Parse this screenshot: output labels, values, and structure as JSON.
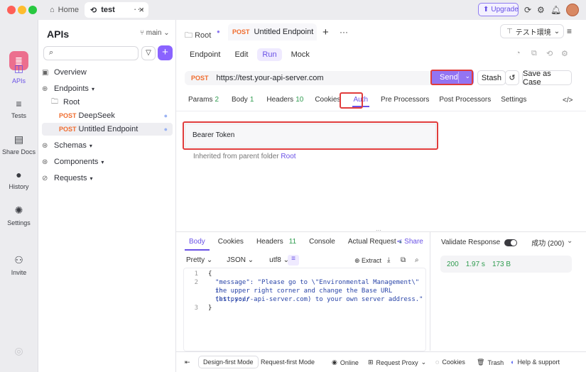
{
  "titlebar": {
    "home": "Home",
    "tab": "test",
    "more": "···",
    "upgrade": "Upgrade"
  },
  "rail": {
    "items": [
      {
        "label": "APIs",
        "icon": "api-icon"
      },
      {
        "label": "Tests",
        "icon": "tests-icon"
      },
      {
        "label": "Share Docs",
        "icon": "docs-icon"
      },
      {
        "label": "History",
        "icon": "history-icon"
      },
      {
        "label": "Settings",
        "icon": "settings-icon"
      },
      {
        "label": "Invite",
        "icon": "invite-icon"
      }
    ]
  },
  "sidebar": {
    "title": "APIs",
    "branch": "main",
    "items": [
      {
        "label": "Overview"
      },
      {
        "label": "Endpoints"
      },
      {
        "label": "Root"
      },
      {
        "method": "POST",
        "label": "DeepSeek"
      },
      {
        "method": "POST",
        "label": "Untitled Endpoint"
      },
      {
        "label": "Schemas"
      },
      {
        "label": "Components"
      },
      {
        "label": "Requests"
      }
    ]
  },
  "header": {
    "root": "Root",
    "method": "POST",
    "tab_title": "Untitled Endpoint",
    "env": "テスト環境"
  },
  "subtabs": [
    "Endpoint",
    "Edit",
    "Run",
    "Mock"
  ],
  "request": {
    "method": "POST",
    "url": "https://test.your-api-server.com",
    "send": "Send",
    "stash": "Stash",
    "save": "Save as Case"
  },
  "params_tabs": [
    {
      "label": "Params",
      "count": "2"
    },
    {
      "label": "Body",
      "count": "1"
    },
    {
      "label": "Headers",
      "count": "10"
    },
    {
      "label": "Cookies",
      "count": ""
    },
    {
      "label": "Auth",
      "count": ""
    },
    {
      "label": "Pre Processors",
      "count": ""
    },
    {
      "label": "Post Processors",
      "count": ""
    },
    {
      "label": "Settings",
      "count": ""
    }
  ],
  "auth": {
    "type": "Bearer Token",
    "inherited": "Inherited from parent folder",
    "inherited_link": "Root"
  },
  "response": {
    "tabs": [
      {
        "label": "Body",
        "count": ""
      },
      {
        "label": "Cookies",
        "count": ""
      },
      {
        "label": "Headers",
        "count": "11"
      },
      {
        "label": "Console",
        "count": ""
      },
      {
        "label": "Actual Request",
        "count": ""
      }
    ],
    "share": "Share",
    "format": "Pretty",
    "lang": "JSON",
    "enc": "utf8",
    "extract": "Extract",
    "validate": "Validate Response",
    "status_text": "成功 (200)",
    "code": "200",
    "time": "1.97 s",
    "size": "173 B",
    "lines": [
      {
        "n": "1",
        "t": "{"
      },
      {
        "n": "2",
        "t": "\"message\": \"Please go to \\\"Environmental Management\\\" in"
      },
      {
        "n": "",
        "t": "the upper right corner and change the Base URL (https://"
      },
      {
        "n": "",
        "t": "test.your-api-server.com) to your own server address.\""
      },
      {
        "n": "3",
        "t": "}"
      }
    ]
  },
  "footer": {
    "design": "Design-first Mode",
    "request": "Request-first Mode",
    "online": "Online",
    "proxy": "Request Proxy",
    "cookies": "Cookies",
    "trash": "Trash",
    "help": "Help & support"
  },
  "colors": {
    "accent": "#6a52e6",
    "method": "#f06c2e",
    "highlight": "#e03c3c"
  }
}
